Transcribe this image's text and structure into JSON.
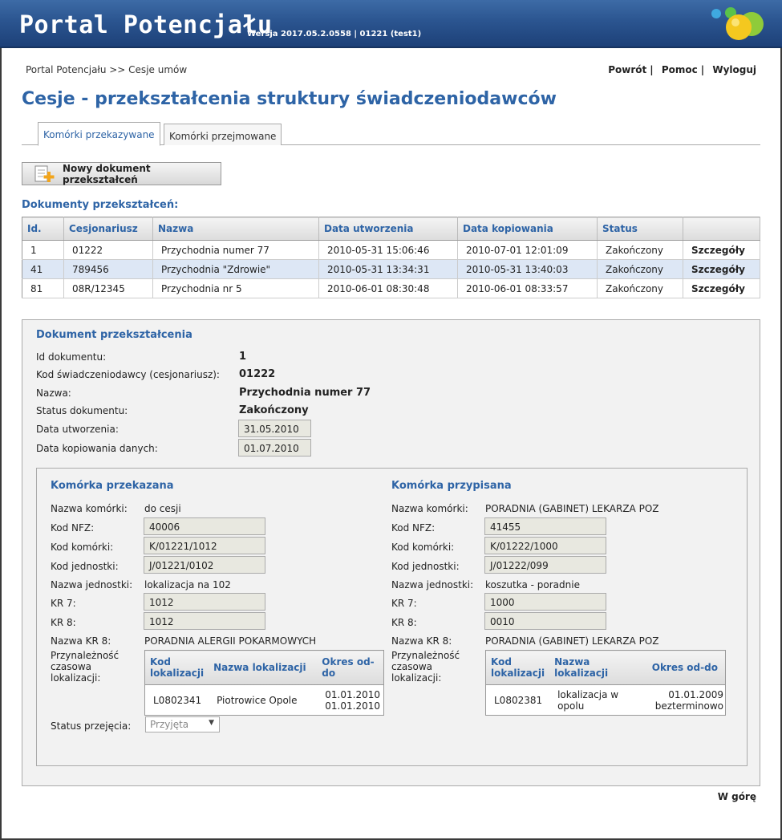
{
  "header": {
    "title": "Portal Potencjału",
    "version": "Wersja 2017.05.2.0558 | 01221 (test1)",
    "logo_icon": "colored-balls-logo"
  },
  "breadcrumb": "Portal Potencjału >> Cesje umów",
  "toplinks": {
    "back": "Powrót",
    "help": "Pomoc",
    "logout": "Wyloguj",
    "sep": "|"
  },
  "page_title": "Cesje - przekształcenia struktury świadczeniodawców",
  "tabs": [
    {
      "label": "Komórki przekazywane",
      "active": true
    },
    {
      "label": "Komórki przejmowane",
      "active": false
    }
  ],
  "new_button": "Nowy dokument przekształceń",
  "docs_section_label": "Dokumenty przekształceń:",
  "docs_table": {
    "headers": [
      "Id.",
      "Cesjonariusz",
      "Nazwa",
      "Data utworzenia",
      "Data kopiowania",
      "Status",
      ""
    ],
    "rows": [
      [
        "1",
        "01222",
        "Przychodnia numer 77",
        "2010-05-31 15:06:46",
        "2010-07-01 12:01:09",
        "Zakończony",
        "Szczegóły"
      ],
      [
        "41",
        "789456",
        "Przychodnia \"Zdrowie\"",
        "2010-05-31 13:34:31",
        "2010-05-31 13:40:03",
        "Zakończony",
        "Szczegóły"
      ],
      [
        "81",
        "08R/12345",
        "Przychodnia nr 5",
        "2010-06-01 08:30:48",
        "2010-06-01 08:33:57",
        "Zakończony",
        "Szczegóły"
      ]
    ]
  },
  "detail": {
    "title": "Dokument przekształcenia",
    "fields": {
      "id_label": "Id dokumentu:",
      "id_value": "1",
      "kod_label": "Kod świadczeniodawcy (cesjonariusz):",
      "kod_value": "01222",
      "nazwa_label": "Nazwa:",
      "nazwa_value": "Przychodnia numer 77",
      "status_label": "Status dokumentu:",
      "status_value": "Zakończony",
      "created_label": "Data utworzenia:",
      "created_value": "31.05.2010",
      "copied_label": "Data kopiowania danych:",
      "copied_value": "01.07.2010"
    },
    "left": {
      "title": "Komórka przekazana",
      "labels": {
        "name": "Nazwa komórki:",
        "nfz": "Kod NFZ:",
        "kom": "Kod komórki:",
        "jedn": "Kod jednostki:",
        "jname": "Nazwa jednostki:",
        "kr7": "KR 7:",
        "kr8": "KR 8:",
        "kr8name": "Nazwa KR 8:",
        "loc": "Przynależność czasowa lokalizacji:",
        "status": "Status przejęcia:"
      },
      "values": {
        "name": "do cesji",
        "nfz": "40006",
        "kom": "K/01221/1012",
        "jedn": "J/01221/0102",
        "jname": "lokalizacja na 102",
        "kr7": "1012",
        "kr8": "1012",
        "kr8name": "PORADNIA ALERGII POKARMOWYCH"
      },
      "loc_headers": [
        "Kod lokalizacji",
        "Nazwa lokalizacji",
        "Okres od-do"
      ],
      "loc_row": {
        "code": "L0802341",
        "name": "Piotrowice Opole",
        "from": "01.01.2010",
        "to": "01.01.2010"
      },
      "status_select": "Przyjęta"
    },
    "right": {
      "title": "Komórka przypisana",
      "labels": {
        "name": "Nazwa komórki:",
        "nfz": "Kod NFZ:",
        "kom": "Kod komórki:",
        "jedn": "Kod jednostki:",
        "jname": "Nazwa jednostki:",
        "kr7": "KR 7:",
        "kr8": "KR 8:",
        "kr8name": "Nazwa KR 8:",
        "loc": "Przynależność czasowa lokalizacji:"
      },
      "values": {
        "name": "PORADNIA (GABINET) LEKARZA POZ",
        "nfz": "41455",
        "kom": "K/01222/1000",
        "jedn": "J/01222/099",
        "jname": "koszutka - poradnie",
        "kr7": "1000",
        "kr8": "0010",
        "kr8name": "PORADNIA (GABINET) LEKARZA POZ"
      },
      "loc_headers": [
        "Kod lokalizacji",
        "Nazwa lokalizacji",
        "Okres od-do"
      ],
      "loc_row": {
        "code": "L0802381",
        "name": "lokalizacja w opolu",
        "from": "01.01.2009",
        "to": "bezterminowo"
      }
    }
  },
  "to_top": "W górę"
}
